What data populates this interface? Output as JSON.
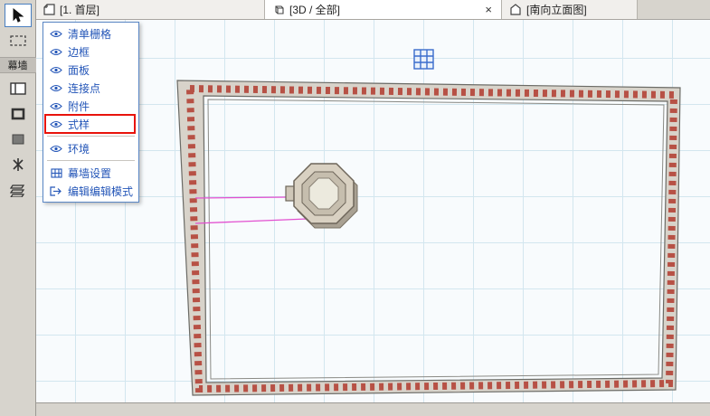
{
  "tabs": [
    {
      "label": "[1. 首层]"
    },
    {
      "label": "[3D / 全部]",
      "close": "×"
    },
    {
      "label": "[南向立面图]"
    }
  ],
  "toolbar": {
    "group_label": "幕墙",
    "tools": [
      {
        "name": "select-arrow"
      },
      {
        "name": "marquee"
      },
      {
        "name": "curtain-wall-boundary"
      },
      {
        "name": "curtain-wall-frame"
      },
      {
        "name": "curtain-wall-panel"
      },
      {
        "name": "curtain-wall-junction"
      },
      {
        "name": "curtain-wall-accessory"
      }
    ]
  },
  "menu": {
    "items": [
      {
        "label": "清单栅格"
      },
      {
        "label": "边框"
      },
      {
        "label": "面板"
      },
      {
        "label": "连接点"
      },
      {
        "label": "附件"
      },
      {
        "label": "式样",
        "highlighted": true
      },
      {
        "label": "环境"
      },
      {
        "label": "幕墙设置"
      },
      {
        "label": "编辑编辑模式"
      }
    ]
  },
  "colors": {
    "accent_blue": "#2456b8",
    "menu_border": "#5b87c5",
    "highlight_red": "#e8140c",
    "magenta": "#e24fd0",
    "frame_red": "#b23a2e",
    "frame_gray": "#d8d3ca",
    "grid_blue": "#3a6ccc",
    "canvas_bg": "#f8fbfd",
    "grid_line": "#d3e6ef",
    "chrome_bg": "#d7d4cd"
  }
}
